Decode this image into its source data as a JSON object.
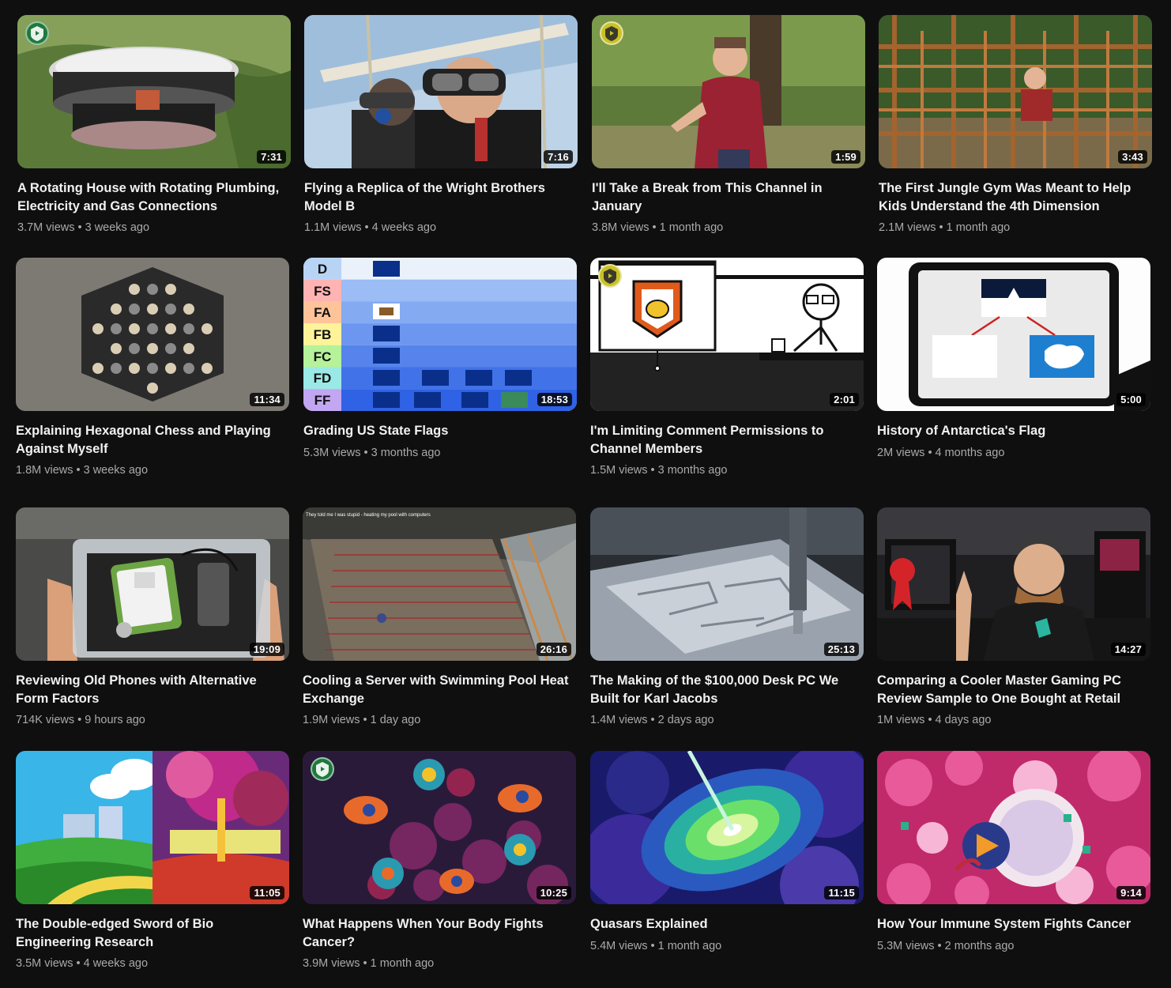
{
  "videos": [
    {
      "title": "A Rotating House with Rotating Plumbing, Electricity and Gas Connections",
      "views": "3.7M views",
      "age": "3 weeks ago",
      "duration": "7:31"
    },
    {
      "title": "Flying a Replica of the Wright Brothers Model B",
      "views": "1.1M views",
      "age": "4 weeks ago",
      "duration": "7:16"
    },
    {
      "title": "I'll Take a Break from This Channel in January",
      "views": "3.8M views",
      "age": "1 month ago",
      "duration": "1:59"
    },
    {
      "title": "The First Jungle Gym Was Meant to Help Kids Understand the 4th Dimension",
      "views": "2.1M views",
      "age": "1 month ago",
      "duration": "3:43"
    },
    {
      "title": "Explaining Hexagonal Chess and Playing Against Myself",
      "views": "1.8M views",
      "age": "3 weeks ago",
      "duration": "11:34"
    },
    {
      "title": "Grading US State Flags",
      "views": "5.3M views",
      "age": "3 months ago",
      "duration": "18:53"
    },
    {
      "title": "I'm Limiting Comment Permissions to Channel Members",
      "views": "1.5M views",
      "age": "3 months ago",
      "duration": "2:01"
    },
    {
      "title": "History of Antarctica's Flag",
      "views": "2M views",
      "age": "4 months ago",
      "duration": "5:00"
    },
    {
      "title": "Reviewing Old Phones with Alternative Form Factors",
      "views": "714K views",
      "age": "9 hours ago",
      "duration": "19:09"
    },
    {
      "title": "Cooling a Server with Swimming Pool Heat Exchange",
      "views": "1.9M views",
      "age": "1 day ago",
      "duration": "26:16"
    },
    {
      "title": "The Making of the $100,000 Desk PC We Built for Karl Jacobs",
      "views": "1.4M views",
      "age": "2 days ago",
      "duration": "25:13"
    },
    {
      "title": "Comparing a Cooler Master Gaming PC Review Sample to One Bought at Retail",
      "views": "1M views",
      "age": "4 days ago",
      "duration": "14:27"
    },
    {
      "title": "The Double-edged Sword of Bio Engineering Research",
      "views": "3.5M views",
      "age": "4 weeks ago",
      "duration": "11:05"
    },
    {
      "title": "What Happens When Your Body Fights Cancer?",
      "views": "3.9M views",
      "age": "1 month ago",
      "duration": "10:25"
    },
    {
      "title": "Quasars Explained",
      "views": "5.4M views",
      "age": "1 month ago",
      "duration": "11:15"
    },
    {
      "title": "How Your Immune System Fights Cancer",
      "views": "5.3M views",
      "age": "2 months ago",
      "duration": "9:14"
    }
  ],
  "thumbnail_text": {
    "tier_labels": [
      "D",
      "FS",
      "FA",
      "FB",
      "FC",
      "FD",
      "FF"
    ],
    "pool_caption": "They told me I was stupid - heating my pool with computers"
  },
  "colors": {
    "background": "#0f0f0f",
    "title": "#f1f1f1",
    "meta": "#aaaaaa",
    "duration_bg": "#000000",
    "badge_green": "#1e7a3c",
    "badge_yellow": "#c9c227"
  },
  "icons": {
    "member_badge": "play-badge-icon",
    "separator": "•"
  }
}
